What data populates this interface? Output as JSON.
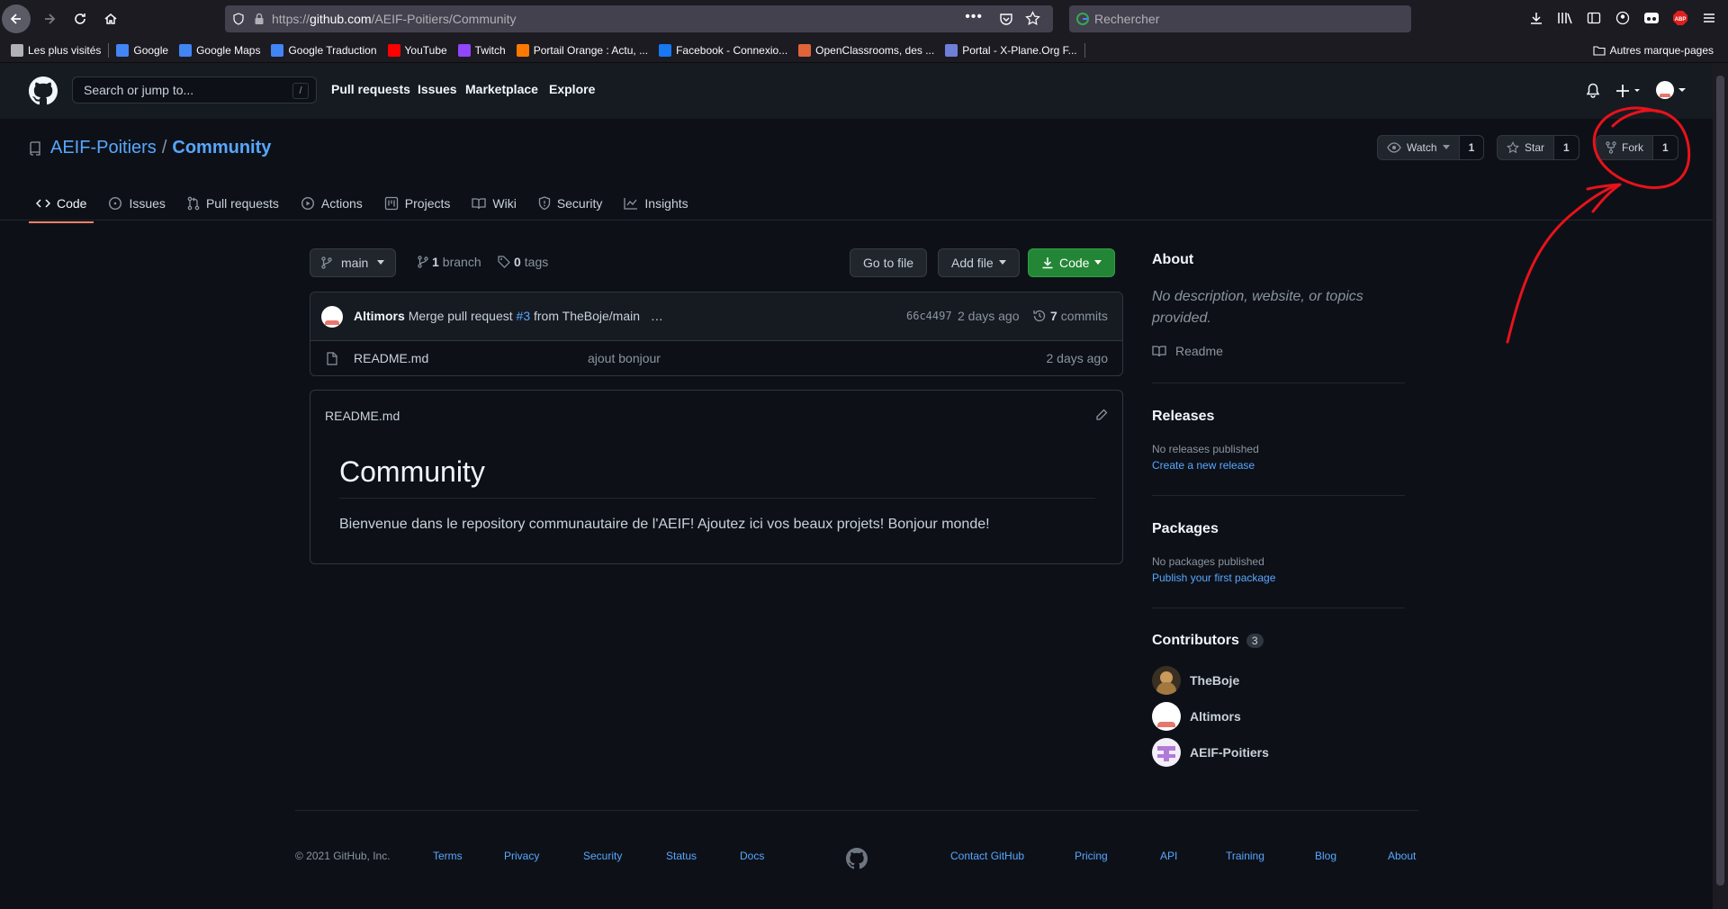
{
  "browser": {
    "url_host": "github.com",
    "url_prefix": "https://",
    "url_path": "/AEIF-Poitiers/Community",
    "search_placeholder": "Rechercher",
    "bookmarks": [
      {
        "label": "Les plus visités",
        "icon": "gear-icon",
        "color": "#b0b0b8"
      },
      {
        "label": "Google",
        "icon": "google-icon",
        "color": "#4285f4"
      },
      {
        "label": "Google Maps",
        "icon": "google-icon",
        "color": "#4285f4"
      },
      {
        "label": "Google Traduction",
        "icon": "google-translate-icon",
        "color": "#4285f4"
      },
      {
        "label": "YouTube",
        "icon": "youtube-icon",
        "color": "#ff0000"
      },
      {
        "label": "Twitch",
        "icon": "twitch-icon",
        "color": "#9146ff"
      },
      {
        "label": "Portail Orange : Actu, ...",
        "icon": "orange-icon",
        "color": "#ff7900"
      },
      {
        "label": "Facebook - Connexio...",
        "icon": "facebook-icon",
        "color": "#1877f2"
      },
      {
        "label": "OpenClassrooms, des ...",
        "icon": "openclassrooms-icon",
        "color": "#e0643a"
      },
      {
        "label": "Portal - X-Plane.Org F...",
        "icon": "xplane-icon",
        "color": "#6f7fd8"
      }
    ],
    "other_bookmarks": "Autres marque-pages"
  },
  "gh_header": {
    "search_placeholder": "Search or jump to...",
    "slash_key": "/",
    "nav": [
      "Pull requests",
      "Issues",
      "Marketplace",
      "Explore"
    ]
  },
  "repo": {
    "owner": "AEIF-Poitiers",
    "separator": "/",
    "name": "Community",
    "watch_label": "Watch",
    "watch_count": "1",
    "star_label": "Star",
    "star_count": "1",
    "fork_label": "Fork",
    "fork_count": "1",
    "tabs": [
      "Code",
      "Issues",
      "Pull requests",
      "Actions",
      "Projects",
      "Wiki",
      "Security",
      "Insights"
    ]
  },
  "main": {
    "branch": "main",
    "branch_count": "1",
    "branch_word": "branch",
    "tag_count": "0",
    "tag_word": "tags",
    "go_to_file": "Go to file",
    "add_file": "Add file",
    "code_button": "Code",
    "commit": {
      "author": "Altimors",
      "message_prefix": "Merge pull request",
      "pr_link": "#3",
      "message_suffix": "from TheBoje/main",
      "ellipsis": "…",
      "sha": "66c4497",
      "time": "2 days ago",
      "commit_count": "7",
      "commit_word": "commits"
    },
    "files": [
      {
        "name": "README.md",
        "message": "ajout bonjour",
        "time": "2 days ago"
      }
    ],
    "readme": {
      "filename": "README.md",
      "heading": "Community",
      "body": "Bienvenue dans le repository communautaire de l'AEIF! Ajoutez ici vos beaux projets! Bonjour monde!"
    }
  },
  "sidebar": {
    "about_title": "About",
    "about_desc": "No description, website, or topics provided.",
    "readme_label": "Readme",
    "releases_title": "Releases",
    "releases_none": "No releases published",
    "releases_link": "Create a new release",
    "packages_title": "Packages",
    "packages_none": "No packages published",
    "packages_link": "Publish your first package",
    "contributors_title": "Contributors",
    "contributors_count": "3",
    "contributors": [
      "TheBoje",
      "Altimors",
      "AEIF-Poitiers"
    ]
  },
  "footer": {
    "copyright": "© 2021 GitHub, Inc.",
    "links_left": [
      "Terms",
      "Privacy",
      "Security",
      "Status",
      "Docs"
    ],
    "links_right": [
      "Contact GitHub",
      "Pricing",
      "API",
      "Training",
      "Blog",
      "About"
    ]
  },
  "colors": {
    "accent_link": "#58a6ff",
    "green_button": "#238636",
    "annotation": "#e8121b"
  }
}
